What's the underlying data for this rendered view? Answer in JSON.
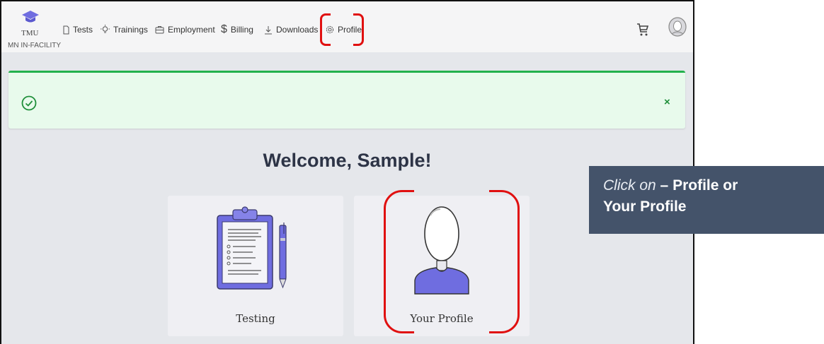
{
  "logo": {
    "text": "TMU",
    "subtitle": "MN IN-FACILITY"
  },
  "nav": {
    "items": [
      {
        "label": "Tests",
        "icon": "document-icon"
      },
      {
        "label": "Trainings",
        "icon": "lightbulb-icon"
      },
      {
        "label": "Employment",
        "icon": "briefcase-icon"
      },
      {
        "label": "Billing",
        "icon": "dollar-icon"
      },
      {
        "label": "Downloads",
        "icon": "download-icon"
      },
      {
        "label": "Profile",
        "icon": "gear-icon"
      }
    ]
  },
  "header_icons": {
    "cart": "cart-icon",
    "avatar": "user-avatar-icon"
  },
  "alert": {
    "status_icon": "check-circle-icon",
    "close": "×",
    "color": "#22b14c"
  },
  "welcome": "Welcome, Sample!",
  "cards": [
    {
      "label": "Testing",
      "icon": "clipboard-icon"
    },
    {
      "label": "Your Profile",
      "icon": "person-icon"
    }
  ],
  "callout": {
    "prefix": "Click on",
    "dash": " – ",
    "line1": "Profile or",
    "line2": "Your Profile"
  },
  "colors": {
    "accent": "#6f6de0",
    "highlight": "#e01010",
    "callout_bg": "#44536a"
  }
}
